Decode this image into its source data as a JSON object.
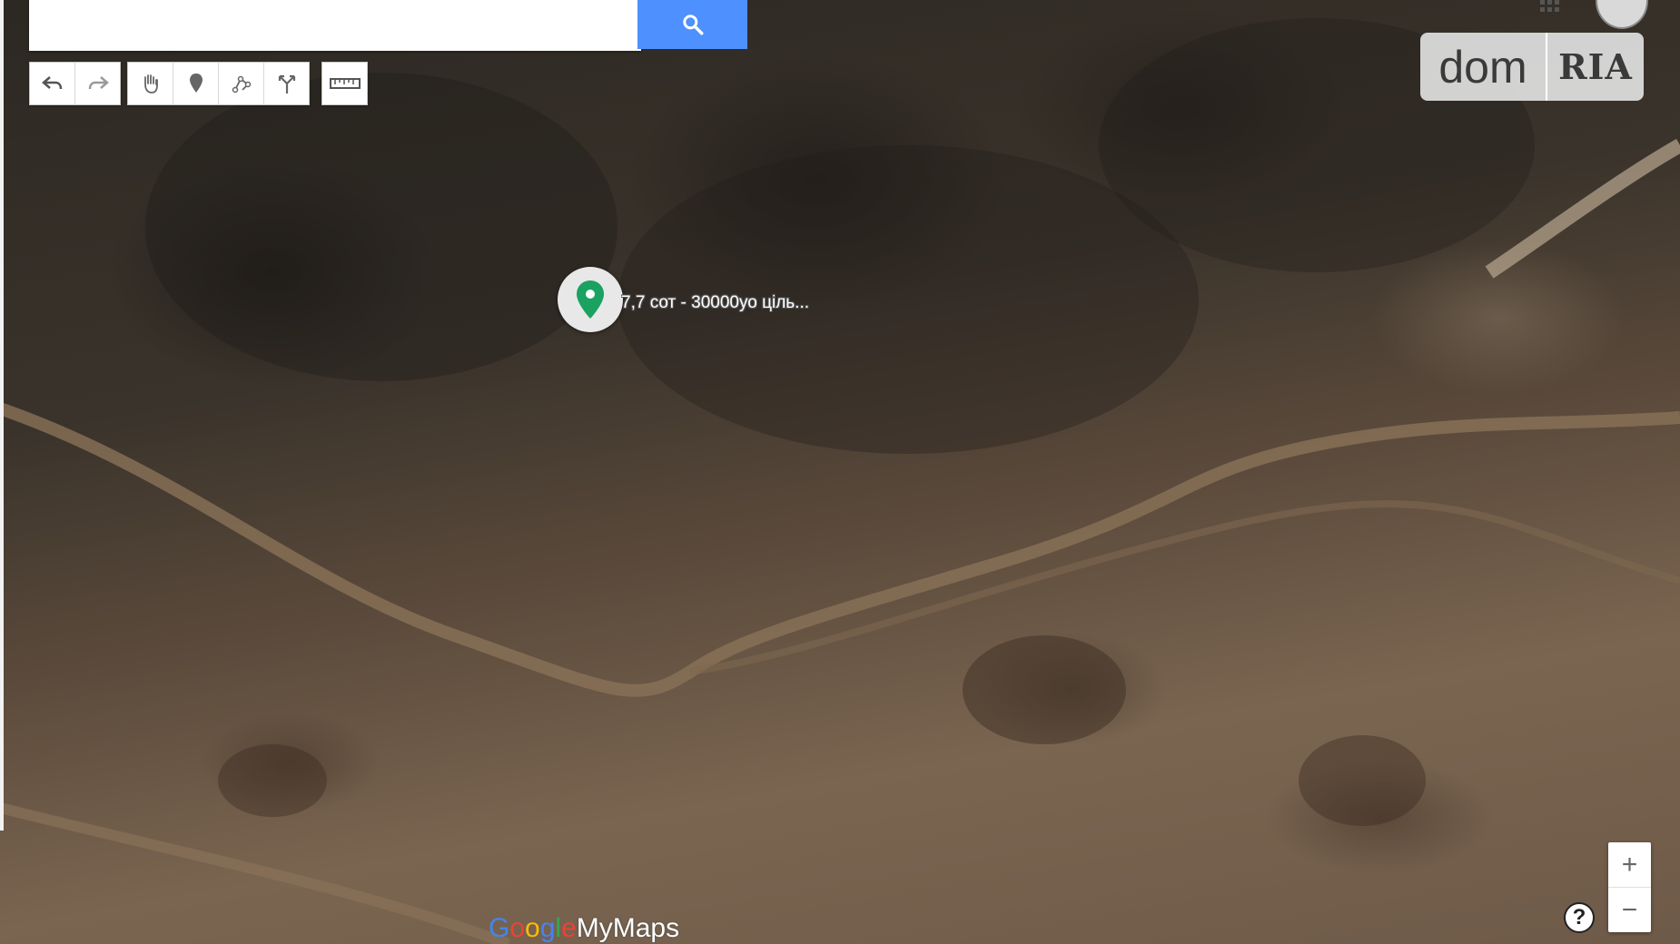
{
  "search": {
    "placeholder": "",
    "value": ""
  },
  "toolbar": {
    "history": [
      {
        "icon": "undo-icon"
      },
      {
        "icon": "redo-icon"
      }
    ],
    "tools": [
      {
        "icon": "hand-icon"
      },
      {
        "icon": "add-marker-icon"
      },
      {
        "icon": "draw-line-icon"
      },
      {
        "icon": "directions-icon"
      }
    ],
    "measure": {
      "icon": "ruler-icon"
    }
  },
  "logo": {
    "left": "dom",
    "right": "RIA"
  },
  "marker": {
    "label": "7,7 сот - 30000уо ціль...",
    "color": "#1aa260"
  },
  "zoom": {
    "in": "+",
    "out": "−"
  },
  "help": {
    "label": "?"
  },
  "brand": {
    "g": "G",
    "o1": "o",
    "o2": "o",
    "g2": "g",
    "l": "l",
    "e": "e",
    "maps": "MyMaps"
  },
  "colors": {
    "search_button": "#4d90fe",
    "marker_green": "#1aa260"
  }
}
